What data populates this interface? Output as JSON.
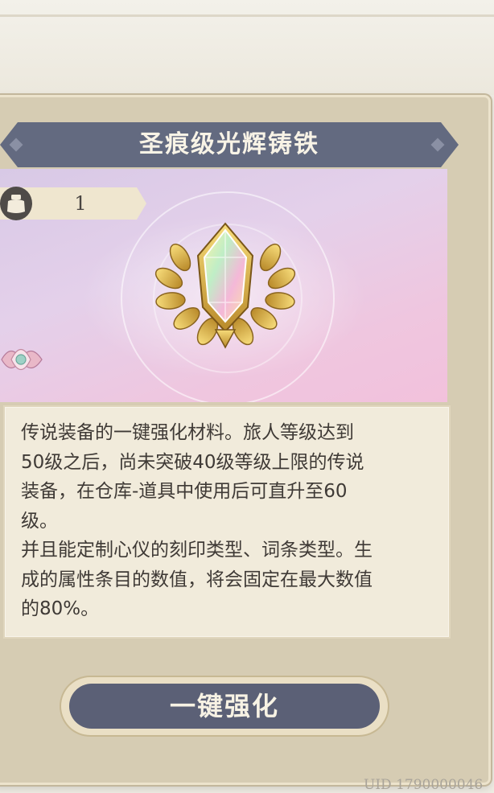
{
  "item": {
    "title": "圣痕级光辉铸铁",
    "count": "1",
    "description": "传说装备的一键强化材料。旅人等级达到\n50级之后，尚未突破40级等级上限的传说\n装备，在仓库-道具中使用后可直升至60\n级。\n并且能定制心仪的刻印类型、词条类型。生\n成的属性条目的数值，将会固定在最大数值\n的80%。",
    "icon": "radiant-crystal-laurel-icon",
    "rarity_icon": "lotus-rarity-icon"
  },
  "actions": {
    "enhance_label": "一键强化"
  },
  "footer": {
    "uid": "UID 1790000046"
  },
  "colors": {
    "ribbon": "#636a80",
    "button": "#5b6076",
    "panel": "#d6ccb3",
    "desc_bg": "#f1ebdb"
  }
}
